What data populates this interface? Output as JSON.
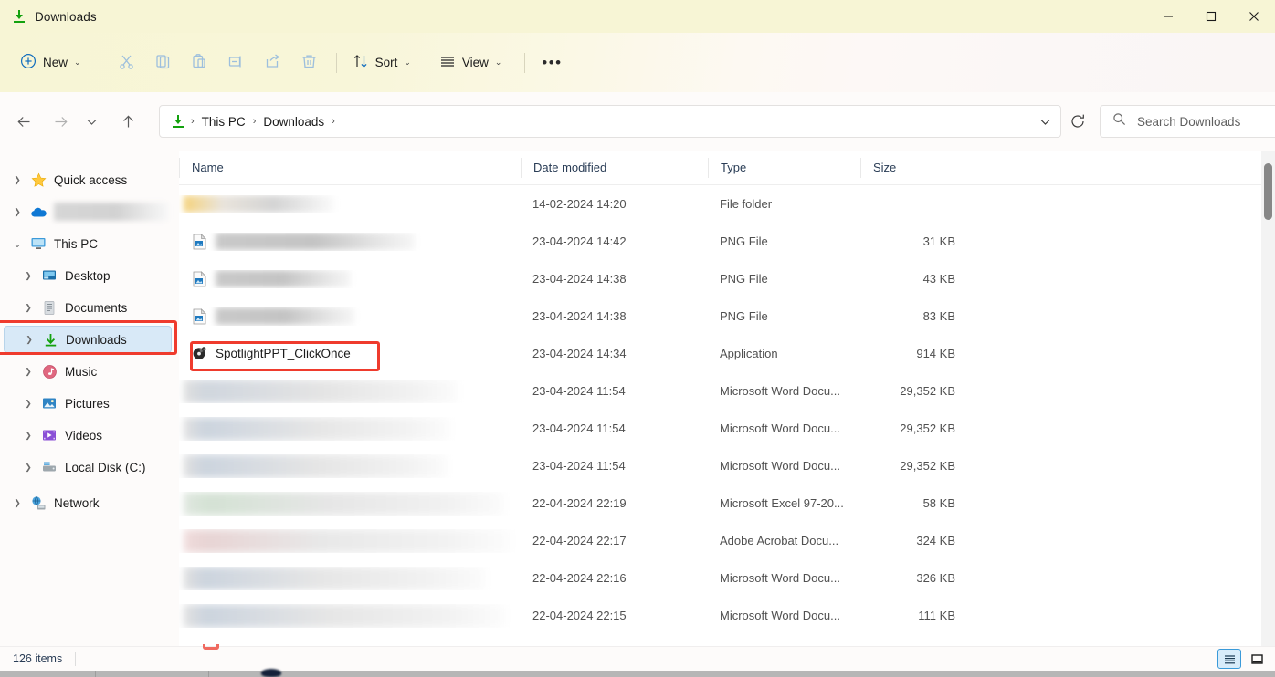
{
  "window": {
    "title": "Downloads",
    "title_icon": "download-arrow-icon",
    "accent_color": "#13a10e",
    "titlebar_color": "#f7f5d5",
    "controls": [
      {
        "name": "minimize-button",
        "glyph": "minimize-icon"
      },
      {
        "name": "maximize-button",
        "glyph": "maximize-icon"
      },
      {
        "name": "close-button",
        "glyph": "close-icon"
      }
    ]
  },
  "command_bar": {
    "new_label": "New",
    "new_icon": "plus-circle-icon",
    "sort_label": "Sort",
    "sort_icon": "sort-arrows-icon",
    "view_label": "View",
    "view_icon": "hamburger-lines-icon",
    "more_label": "•••",
    "icon_buttons": [
      {
        "name": "cut-button",
        "icon": "scissors-icon"
      },
      {
        "name": "copy-button",
        "icon": "copy-icon"
      },
      {
        "name": "paste-button",
        "icon": "clipboard-paste-icon"
      },
      {
        "name": "rename-button",
        "icon": "rename-icon"
      },
      {
        "name": "share-button",
        "icon": "share-icon"
      },
      {
        "name": "delete-button",
        "icon": "trash-icon"
      }
    ]
  },
  "navigation": {
    "back_icon": "arrow-left-icon",
    "forward_icon": "arrow-right-icon",
    "recent_icon": "chevron-down-icon",
    "up_icon": "arrow-up-icon",
    "refresh_icon": "refresh-icon",
    "breadcrumb_icon": "download-arrow-icon",
    "breadcrumb": [
      "This PC",
      "Downloads"
    ],
    "breadcrumb_separator": "›",
    "breadcrumb_dropdown_icon": "chevron-down-icon"
  },
  "search": {
    "placeholder": "Search Downloads",
    "icon": "search-icon",
    "value": ""
  },
  "sidebar": {
    "items": [
      {
        "label": "Quick access",
        "icon": "star-icon",
        "level": 1,
        "expander": "›",
        "redacted": false,
        "selected": false
      },
      {
        "label": "",
        "icon": "onedrive-cloud-icon",
        "level": 1,
        "expander": "›",
        "redacted": true,
        "redact_width": 125,
        "selected": false
      },
      {
        "label": "This PC",
        "icon": "monitor-icon",
        "level": 1,
        "expander": "⌄",
        "expanded": true,
        "redacted": false,
        "selected": false
      },
      {
        "label": "Desktop",
        "icon": "desktop-folder-icon",
        "level": 2,
        "expander": "›",
        "redacted": false,
        "selected": false
      },
      {
        "label": "Documents",
        "icon": "documents-icon",
        "level": 2,
        "expander": "›",
        "redacted": false,
        "selected": false
      },
      {
        "label": "Downloads",
        "icon": "download-arrow-icon",
        "level": 2,
        "expander": "›",
        "redacted": false,
        "selected": true
      },
      {
        "label": "Music",
        "icon": "music-note-icon",
        "level": 2,
        "expander": "›",
        "redacted": false,
        "selected": false
      },
      {
        "label": "Pictures",
        "icon": "pictures-icon",
        "level": 2,
        "expander": "›",
        "redacted": false,
        "selected": false
      },
      {
        "label": "Videos",
        "icon": "videos-icon",
        "level": 2,
        "expander": "›",
        "redacted": false,
        "selected": false
      },
      {
        "label": "Local Disk (C:)",
        "icon": "hard-drive-icon",
        "level": 2,
        "expander": "›",
        "redacted": false,
        "selected": false
      },
      {
        "label": "Network",
        "icon": "network-icon",
        "level": 1,
        "expander": "›",
        "redacted": false,
        "selected": false
      }
    ]
  },
  "file_list": {
    "columns": [
      "Name",
      "Date modified",
      "Type",
      "Size"
    ],
    "rows": [
      {
        "name": "",
        "redacted": true,
        "redact_width": 165,
        "redact_kind": "folder",
        "icon": "folder-icon",
        "date": "14-02-2024 14:20",
        "type": "File folder",
        "size": ""
      },
      {
        "name": "",
        "redacted": true,
        "redact_width": 218,
        "redact_kind": "grey",
        "icon": "png-file-icon",
        "date": "23-04-2024 14:42",
        "type": "PNG File",
        "size": "31 KB"
      },
      {
        "name": "",
        "redacted": true,
        "redact_width": 148,
        "redact_kind": "grey",
        "icon": "png-file-icon",
        "date": "23-04-2024 14:38",
        "type": "PNG File",
        "size": "43 KB"
      },
      {
        "name": "",
        "redacted": true,
        "redact_width": 152,
        "redact_kind": "grey",
        "icon": "png-file-icon",
        "date": "23-04-2024 14:38",
        "type": "PNG File",
        "size": "83 KB"
      },
      {
        "name": "SpotlightPPT_ClickOnce",
        "redacted": false,
        "icon": "clickonce-app-icon",
        "date": "23-04-2024 14:34",
        "type": "Application",
        "size": "914 KB",
        "annotated": true
      },
      {
        "name": "",
        "redacted": true,
        "redact_width": 245,
        "redact_kind": "grey",
        "icon": "word-doc-icon",
        "date": "23-04-2024 11:54",
        "type": "Microsoft Word Docu...",
        "size": "29,352 KB"
      },
      {
        "name": "",
        "redacted": true,
        "redact_width": 243,
        "redact_kind": "grey",
        "icon": "word-doc-icon",
        "date": "23-04-2024 11:54",
        "type": "Microsoft Word Docu...",
        "size": "29,352 KB"
      },
      {
        "name": "",
        "redacted": true,
        "redact_width": 240,
        "redact_kind": "grey",
        "icon": "word-doc-icon",
        "date": "23-04-2024 11:54",
        "type": "Microsoft Word Docu...",
        "size": "29,352 KB"
      },
      {
        "name": "",
        "redacted": true,
        "redact_width": 330,
        "redact_kind": "grey",
        "icon": "excel-doc-icon",
        "date": "22-04-2024 22:19",
        "type": "Microsoft Excel 97-20...",
        "size": "58 KB"
      },
      {
        "name": "",
        "redacted": true,
        "redact_width": 348,
        "redact_kind": "grey",
        "icon": "pdf-doc-icon",
        "date": "22-04-2024 22:17",
        "type": "Adobe Acrobat Docu...",
        "size": "324 KB"
      },
      {
        "name": "",
        "redacted": true,
        "redact_width": 300,
        "redact_kind": "grey",
        "icon": "word-doc-icon",
        "date": "22-04-2024 22:16",
        "type": "Microsoft Word Docu...",
        "size": "326 KB"
      },
      {
        "name": "",
        "redacted": true,
        "redact_width": 318,
        "redact_kind": "grey",
        "icon": "word-doc-icon",
        "date": "22-04-2024 22:15",
        "type": "Microsoft Word Docu...",
        "size": "111 KB"
      }
    ]
  },
  "status_bar": {
    "item_count": "126 items",
    "details_view_icon": "details-view-icon",
    "preview_pane_icon": "preview-pane-icon",
    "active_view": "details-view-icon"
  },
  "annotations": {
    "color": "#ef3b2d",
    "boxes": [
      {
        "name": "sidebar-downloads-highlight",
        "target": "sidebar-item-downloads"
      },
      {
        "name": "file-spotlightppt-highlight",
        "target": "file-row-spotlightppt"
      }
    ]
  }
}
